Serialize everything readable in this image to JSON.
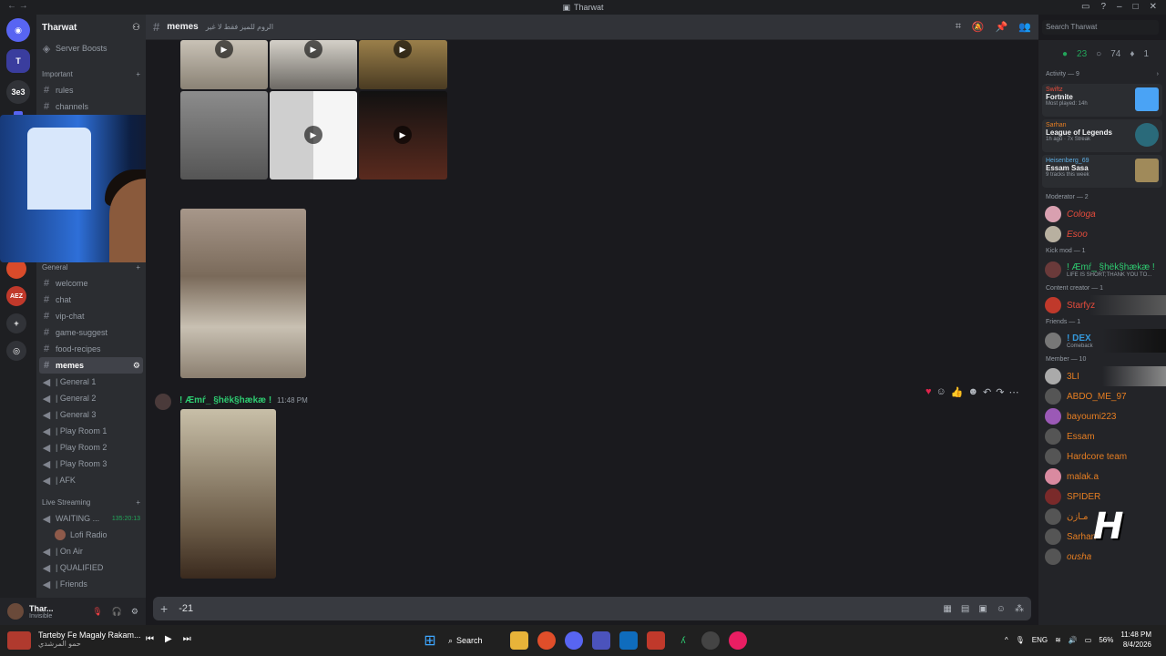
{
  "window": {
    "title": "Tharwat"
  },
  "servers": [
    "3e3"
  ],
  "sidebar": {
    "server_name": "Tharwat",
    "top_items": [
      {
        "label": "Server Boosts"
      }
    ],
    "important_cat": "Important",
    "important": [
      {
        "label": "rules"
      },
      {
        "label": "channels"
      }
    ],
    "general_cat": "General",
    "general": [
      {
        "label": "welcome"
      },
      {
        "label": "chat"
      },
      {
        "label": "vip-chat"
      },
      {
        "label": "game-suggest"
      },
      {
        "label": "food-recipes"
      },
      {
        "label": "memes"
      }
    ],
    "voice": [
      {
        "label": "| General 1"
      },
      {
        "label": "| General 2"
      },
      {
        "label": "| General 3"
      },
      {
        "label": "| Play Room 1"
      },
      {
        "label": "| Play Room 2"
      },
      {
        "label": "| Play Room 3"
      },
      {
        "label": "| AFK"
      }
    ],
    "live_cat": "Live Streaming",
    "live": [
      {
        "label": "WAITING ...",
        "timer": "135:20:13"
      },
      {
        "label": "Lofi Radio"
      },
      {
        "label": "| On Air"
      },
      {
        "label": "| QUALIFIED"
      },
      {
        "label": "| Friends"
      }
    ]
  },
  "topbar": {
    "channel": "memes",
    "topic": "الروم للميز فقط لا غير",
    "search_placeholder": "Search Tharwat"
  },
  "message": {
    "author": "! Æmŕ_ §hëk§hækæ !",
    "time": "11:48 PM"
  },
  "composer": {
    "value": "-21"
  },
  "members": {
    "online": "23",
    "idle": "74",
    "boosts": "1",
    "activity_header": "Activity — 9",
    "activities": [
      {
        "user": "Swiftz",
        "game": "Fortnite",
        "status": "Most played: 14h"
      },
      {
        "user": "Sarhan",
        "game": "League of Legends",
        "status": "1h ago · 7x Streak"
      },
      {
        "user": "Heisenberg_69",
        "game": "Essam Sasa",
        "status": "9 tracks this week"
      }
    ],
    "groups": [
      {
        "header": "Moderator — 2",
        "names": [
          "Cologa",
          "Esoo"
        ]
      },
      {
        "header": "Kick mod — 1",
        "names": [
          "! Æmŕ_ §hëk§hækæ !"
        ],
        "status": "LIFE IS SHORT;THANK YOU TO..."
      },
      {
        "header": "Content creator — 1",
        "names": [
          "Starfyz"
        ]
      },
      {
        "header": "Friends — 1",
        "names": [
          "! DEX"
        ],
        "status": "Comeback"
      },
      {
        "header": "Member — 10",
        "names": [
          "3LI",
          "ABDO_ME_97",
          "bayoumi223",
          "Essam",
          "Hardcore team",
          "malak.a",
          "SPIDER",
          "مـازن",
          "Sarhan",
          "ousha"
        ]
      }
    ]
  },
  "user": {
    "name": "Thar...",
    "status": "Invisible"
  },
  "taskbar": {
    "media_title": "Tarteby Fe Magaly Rakam...",
    "media_artist": "حمو المرشدي",
    "search": "Search",
    "lang": "ENG",
    "battery": "56%",
    "time": "11:48 PM",
    "date": "8/4/2026"
  },
  "colors": {
    "accent": "#5865f2",
    "online": "#23a55a",
    "author": "#2ecc71"
  }
}
